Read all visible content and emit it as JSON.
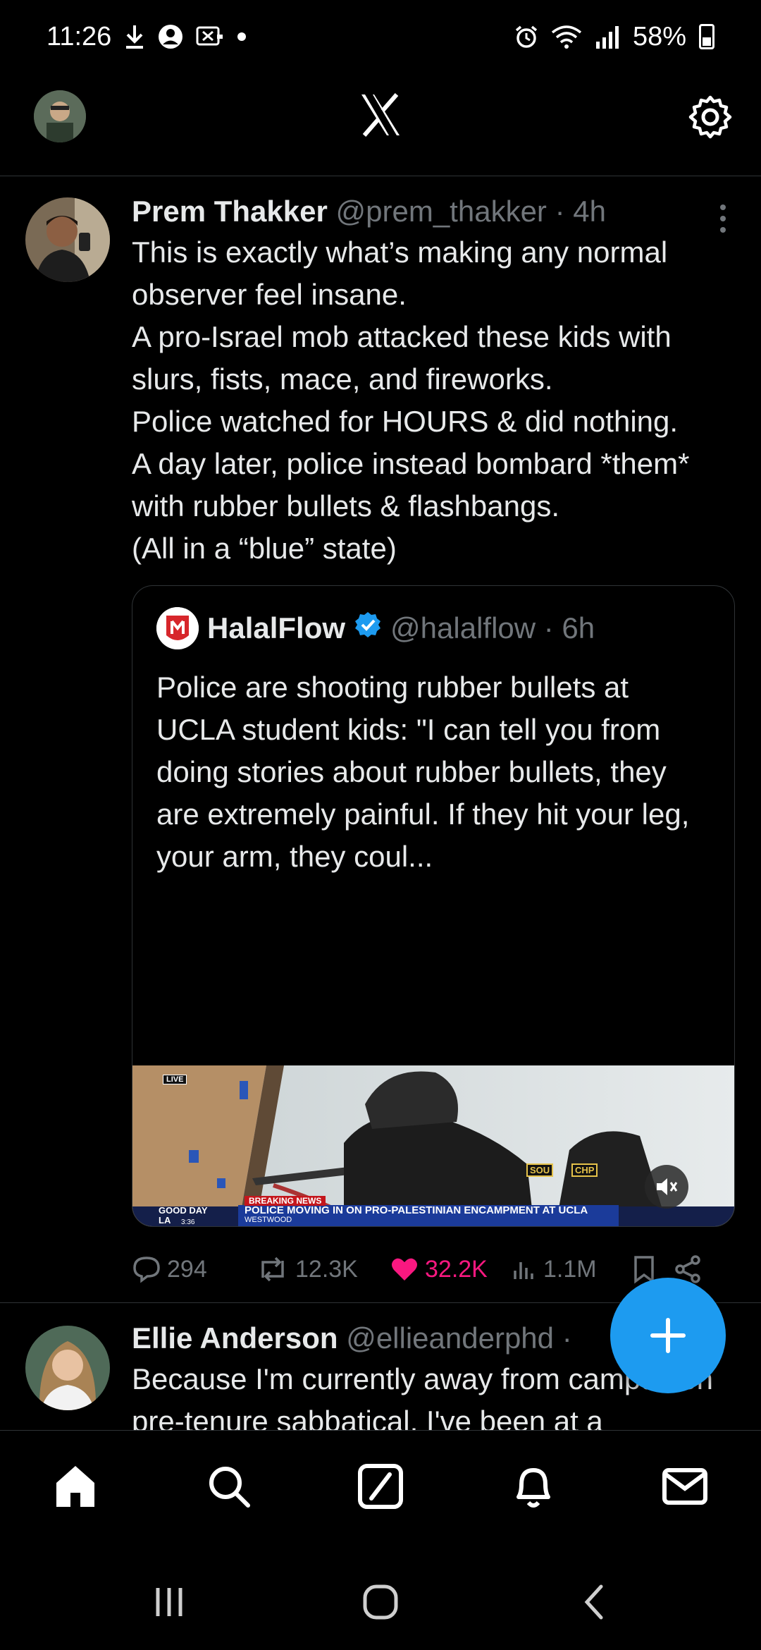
{
  "status_bar": {
    "time": "11:26",
    "battery": "58%",
    "left_icons": [
      "download-icon",
      "account-circle-icon",
      "screen-record-icon",
      "dot-icon"
    ],
    "right_icons": [
      "alarm-icon",
      "wifi-icon",
      "signal-icon",
      "battery-icon"
    ]
  },
  "header": {
    "logo": "x-logo-icon",
    "settings_icon": "gear-icon"
  },
  "tweets": [
    {
      "name": "Prem Thakker",
      "handle": "@prem_thakker · 4h",
      "text": "This is exactly what’s making any normal observer feel insane.\nA pro-Israel mob attacked these kids with slurs, fists, mace, and fireworks.\nPolice watched for HOURS & did nothing.\nA day later, police instead bombard *them* with rubber bullets & flashbangs.\n(All in a “blue” state)",
      "quote": {
        "name": "HalalFlow",
        "handle": "@halalflow · 6h",
        "text": "Police are shooting rubber bullets at UCLA student kids: \"I can tell you from doing stories about rubber bullets, they are extremely painful. If they hit your leg, your arm, they coul...",
        "media": {
          "live_label": "LIVE",
          "breaking_label": "BREAKING NEWS",
          "headline": "POLICE MOVING IN ON PRO-PALESTINIAN ENCAMPMENT AT UCLA",
          "location": "WESTWOOD",
          "station": "GOOD DAY LA",
          "clock": "3:36",
          "vest_text_1": "SOU",
          "vest_text_2": "CHP"
        }
      },
      "actions": {
        "replies": "294",
        "reposts": "12.3K",
        "likes": "32.2K",
        "views": "1.1M"
      }
    },
    {
      "name": "Ellie Anderson",
      "handle": "@ellieanderphd ·",
      "text": "Because I'm currently away from campus on pre-tenure sabbatical, I've been at a"
    }
  ],
  "fab": {
    "icon": "plus-icon"
  },
  "tabbar": [
    "home-icon",
    "search-icon",
    "grok-icon",
    "notifications-icon",
    "messages-icon"
  ],
  "navbar": [
    "recents-icon",
    "home-button-icon",
    "back-icon"
  ]
}
